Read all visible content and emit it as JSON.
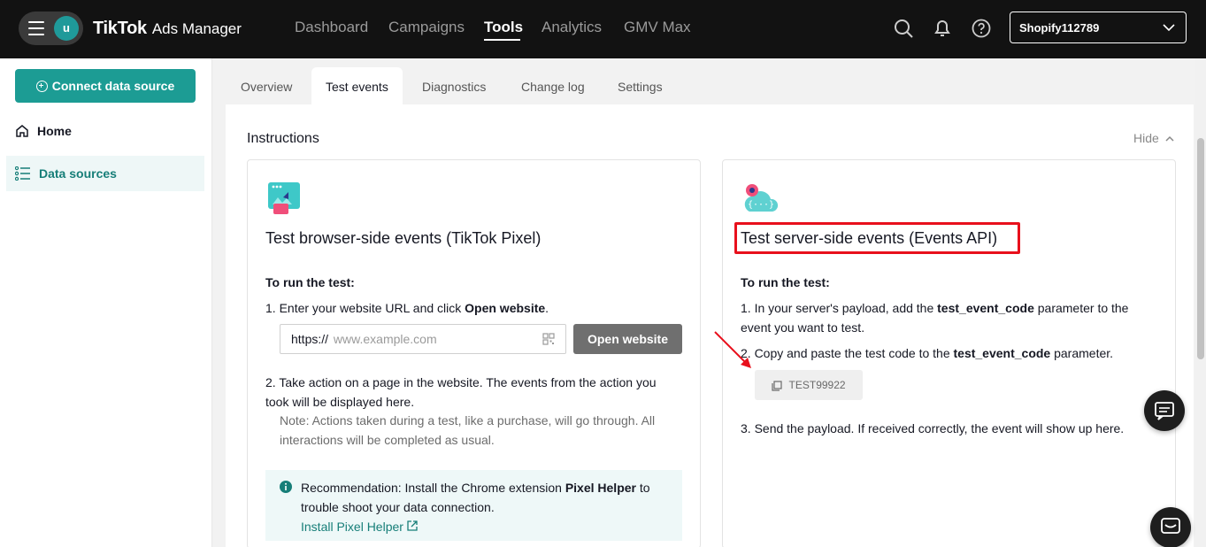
{
  "header": {
    "avatar_letter": "u",
    "brand": "TikTok",
    "product": "Ads Manager",
    "nav": [
      "Dashboard",
      "Campaigns",
      "Tools",
      "Analytics",
      "GMV Max"
    ],
    "active_nav": "Tools",
    "account": "Shopify112789"
  },
  "sidebar": {
    "connect_label": "Connect data source",
    "items": [
      {
        "label": "Home",
        "icon": "home-icon"
      },
      {
        "label": "Data sources",
        "icon": "list-icon",
        "active": true
      }
    ]
  },
  "tabs": [
    "Overview",
    "Test events",
    "Diagnostics",
    "Change log",
    "Settings"
  ],
  "active_tab": "Test events",
  "instructions": {
    "title": "Instructions",
    "hide_label": "Hide"
  },
  "browser_card": {
    "title": "Test browser-side events (TikTok Pixel)",
    "run_label": "To run the test:",
    "step1_prefix": "1. Enter your website URL and click ",
    "step1_bold": "Open website",
    "step1_suffix": ".",
    "url_prefix": "https://",
    "url_placeholder": "www.example.com",
    "open_button": "Open website",
    "step2": "2. Take action on a page in the website. The events from the action you took will be displayed here.",
    "note": "Note: Actions taken during a test, like a purchase, will go through. All interactions will be completed as usual.",
    "reco_prefix": "Recommendation: Install the Chrome extension ",
    "reco_bold": "Pixel Helper",
    "reco_suffix": " to trouble shoot your data connection.",
    "reco_link": "Install Pixel Helper"
  },
  "server_card": {
    "title": "Test server-side events (Events API)",
    "run_label": "To run the test:",
    "step1_prefix": "1. In your server's payload, add the ",
    "step1_bold": "test_event_code",
    "step1_suffix": " parameter to the event you want to test.",
    "step2_prefix": "2. Copy and paste the test code to the ",
    "step2_bold": "test_event_code",
    "step2_suffix": " parameter.",
    "test_code": "TEST99922",
    "step3": "3. Send the payload. If received correctly, the event will show up here."
  },
  "colors": {
    "accent": "#1c9c94",
    "highlight": "#e8101c",
    "topbar": "#121212"
  }
}
